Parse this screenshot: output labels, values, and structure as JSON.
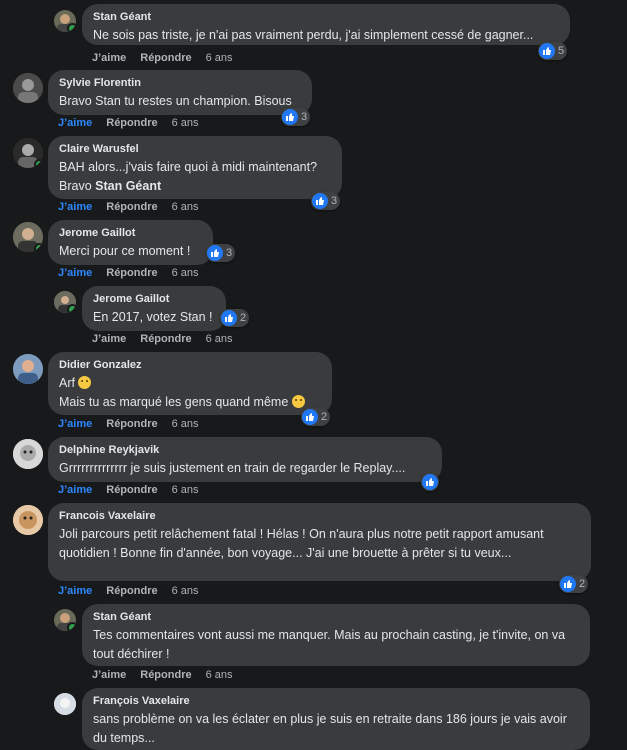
{
  "actions": {
    "like": "J’aime",
    "reply": "Répondre"
  },
  "comments": [
    {
      "name": "Stan Géant",
      "text": "Ne sois pas triste, je n'ai pas vraiment perdu, j'ai simplement cessé de gagner...",
      "time": "6 ans",
      "reactions": "5"
    },
    {
      "name": "Sylvie Florentin",
      "text": "Bravo Stan tu restes un champion. Bisous",
      "time": "6 ans",
      "reactions": "3"
    },
    {
      "name": "Claire Warusfel",
      "text_line1": "BAH alors...j'vais faire quoi à midi maintenant?",
      "text_line2_prefix": "Bravo ",
      "mention": "Stan Géant",
      "time": "6 ans",
      "reactions": "3"
    },
    {
      "name": "Jerome Gaillot",
      "text": "Merci pour ce moment !",
      "time": "6 ans",
      "reactions": "3"
    },
    {
      "name": "Jerome Gaillot",
      "text": "En 2017, votez Stan !",
      "time": "6 ans",
      "reactions": "2"
    },
    {
      "name": "Didier Gonzalez",
      "text_line1": "Arf",
      "text_line2": "Mais tu as marqué les gens quand même",
      "time": "6 ans",
      "reactions": "2"
    },
    {
      "name": "Delphine Reykjavik",
      "text": "Grrrrrrrrrrrrrr je suis justement en train de regarder le Replay....",
      "time": "6 ans",
      "reactions": ""
    },
    {
      "name": "Francois Vaxelaire",
      "text": "Joli parcours petit relâchement fatal ! Hélas ! On n'aura plus notre petit rapport amusant quotidien ! Bonne fin d'année, bon voyage... J'ai une brouette à prêter si tu veux...",
      "time": "6 ans",
      "reactions": "2"
    },
    {
      "name": "Stan Géant",
      "text": "Tes commentaires vont aussi me manquer. Mais au prochain casting, je t'invite, on va tout déchirer !",
      "time": "6 ans",
      "reactions": ""
    },
    {
      "name": "François Vaxelaire",
      "text": "sans problème on va les éclater en plus je suis en retraite dans 186 jours je vais avoir du temps...",
      "time": "",
      "reactions": ""
    }
  ]
}
